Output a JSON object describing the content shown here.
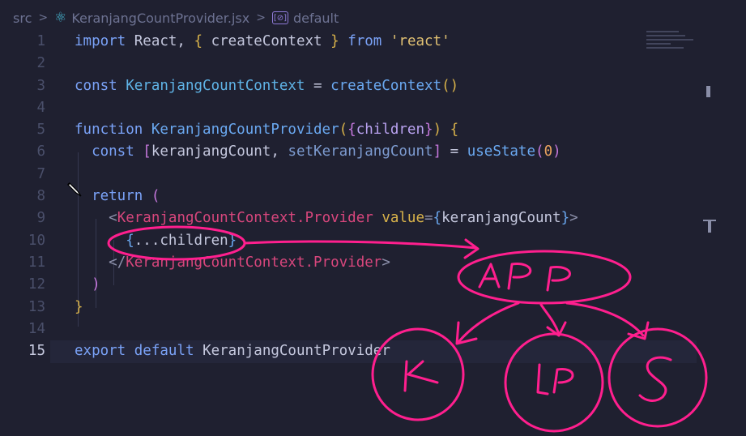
{
  "breadcrumb": {
    "folder": "src",
    "file": "KeranjangCountProvider.jsx",
    "symbol": "default"
  },
  "icons": {
    "file_icon": "react-icon",
    "symbol_icon": "symbol-variable-icon",
    "cursor": "pencil-cursor-icon"
  },
  "colors": {
    "background": "#1f2030",
    "annotation": "#ff1f8e",
    "keyword": "#7aa2f7",
    "string": "#e0c072",
    "tag": "#d7467c"
  },
  "lines": [
    {
      "n": "1"
    },
    {
      "n": "2"
    },
    {
      "n": "3"
    },
    {
      "n": "4"
    },
    {
      "n": "5"
    },
    {
      "n": "6"
    },
    {
      "n": "7"
    },
    {
      "n": "8"
    },
    {
      "n": "9"
    },
    {
      "n": "10"
    },
    {
      "n": "11"
    },
    {
      "n": "12"
    },
    {
      "n": "13"
    },
    {
      "n": "14"
    },
    {
      "n": "15"
    }
  ],
  "code": {
    "l1": {
      "k1": "import",
      "t1": " React, ",
      "b1": "{",
      "t2": " createContext ",
      "b2": "}",
      "k2": " from ",
      "s": "'react'"
    },
    "l3": {
      "k": "const ",
      "name": "KeranjangCountContext",
      "eq": " = ",
      "fn": "createContext",
      "p": "()"
    },
    "l5": {
      "k": "function ",
      "name": "KeranjangCountProvider",
      "p1": "(",
      "b1": "{",
      "param": "children",
      "b2": "}",
      "p2": ")",
      "sp": " ",
      "b3": "{"
    },
    "l6": {
      "k": "const ",
      "b1": "[",
      "v1": "keranjangCount",
      "c": ", ",
      "v2": "setKeranjangCount",
      "b2": "]",
      "eq": " = ",
      "fn": "useState",
      "p1": "(",
      "num": "0",
      "p2": ")"
    },
    "l8": {
      "k": "return ",
      "p": "("
    },
    "l9": {
      "lt": "<",
      "tag": "KeranjangCountContext.Provider",
      "attr": " value",
      "eq": "=",
      "b1": "{",
      "v": "keranjangCount",
      "b2": "}",
      "gt": ">"
    },
    "l10": {
      "b1": "{",
      "t": "...children",
      "b2": "}"
    },
    "l11": {
      "lt": "</",
      "tag": "KeranjangCountContext.Provider",
      "gt": ">"
    },
    "l12": {
      "p": ")"
    },
    "l13": {
      "b": "}"
    },
    "l15": {
      "k1": "export ",
      "k2": "default ",
      "name": "KeranjangCountProvider"
    }
  },
  "annotations": {
    "app_label": "APP",
    "k_label": "K",
    "lp_label": "LP",
    "s_label": "S"
  }
}
